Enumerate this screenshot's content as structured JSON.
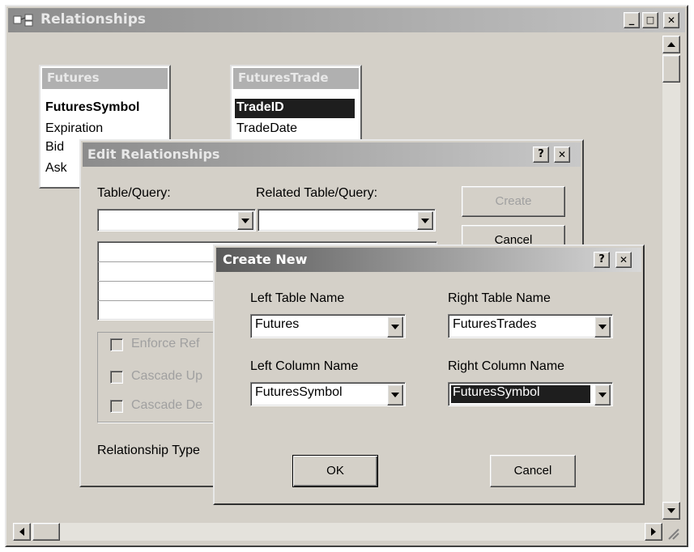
{
  "main_window": {
    "title": "Relationships",
    "min": "_",
    "max": "□",
    "close": "✕"
  },
  "tables": [
    {
      "name": "Futures",
      "fields": [
        "FuturesSymbol",
        "Expiration",
        "Bid",
        "Ask"
      ]
    },
    {
      "name": "FuturesTrade",
      "fields": [
        "TradeID",
        "TradeDate"
      ]
    }
  ],
  "edit_dialog": {
    "title": "Edit Relationships",
    "help": "?",
    "close": "✕",
    "table_query_label": "Table/Query:",
    "related_label": "Related Table/Query:",
    "create_button": "Create",
    "cancel_button": "Cancel",
    "enforce_label": "Enforce Ref",
    "cascade_up_label": "Cascade Up",
    "cascade_del_label": "Cascade De",
    "relationship_type_label": "Relationship Type"
  },
  "create_dialog": {
    "title": "Create New",
    "help": "?",
    "close": "✕",
    "left_table_label": "Left Table Name",
    "left_table_value": "Futures",
    "right_table_label": "Right Table Name",
    "right_table_value": "FuturesTrades",
    "left_column_label": "Left Column Name",
    "left_column_value": "FuturesSymbol",
    "right_column_label": "Right Column Name",
    "right_column_value": "FuturesSymbol",
    "ok_button": "OK",
    "cancel_button": "Cancel"
  },
  "colors": {
    "face": "#d4d0c8",
    "active_title": "#5e5e5e",
    "inactive_title": "#a8a8a8",
    "selection": "#1e1e1e"
  }
}
